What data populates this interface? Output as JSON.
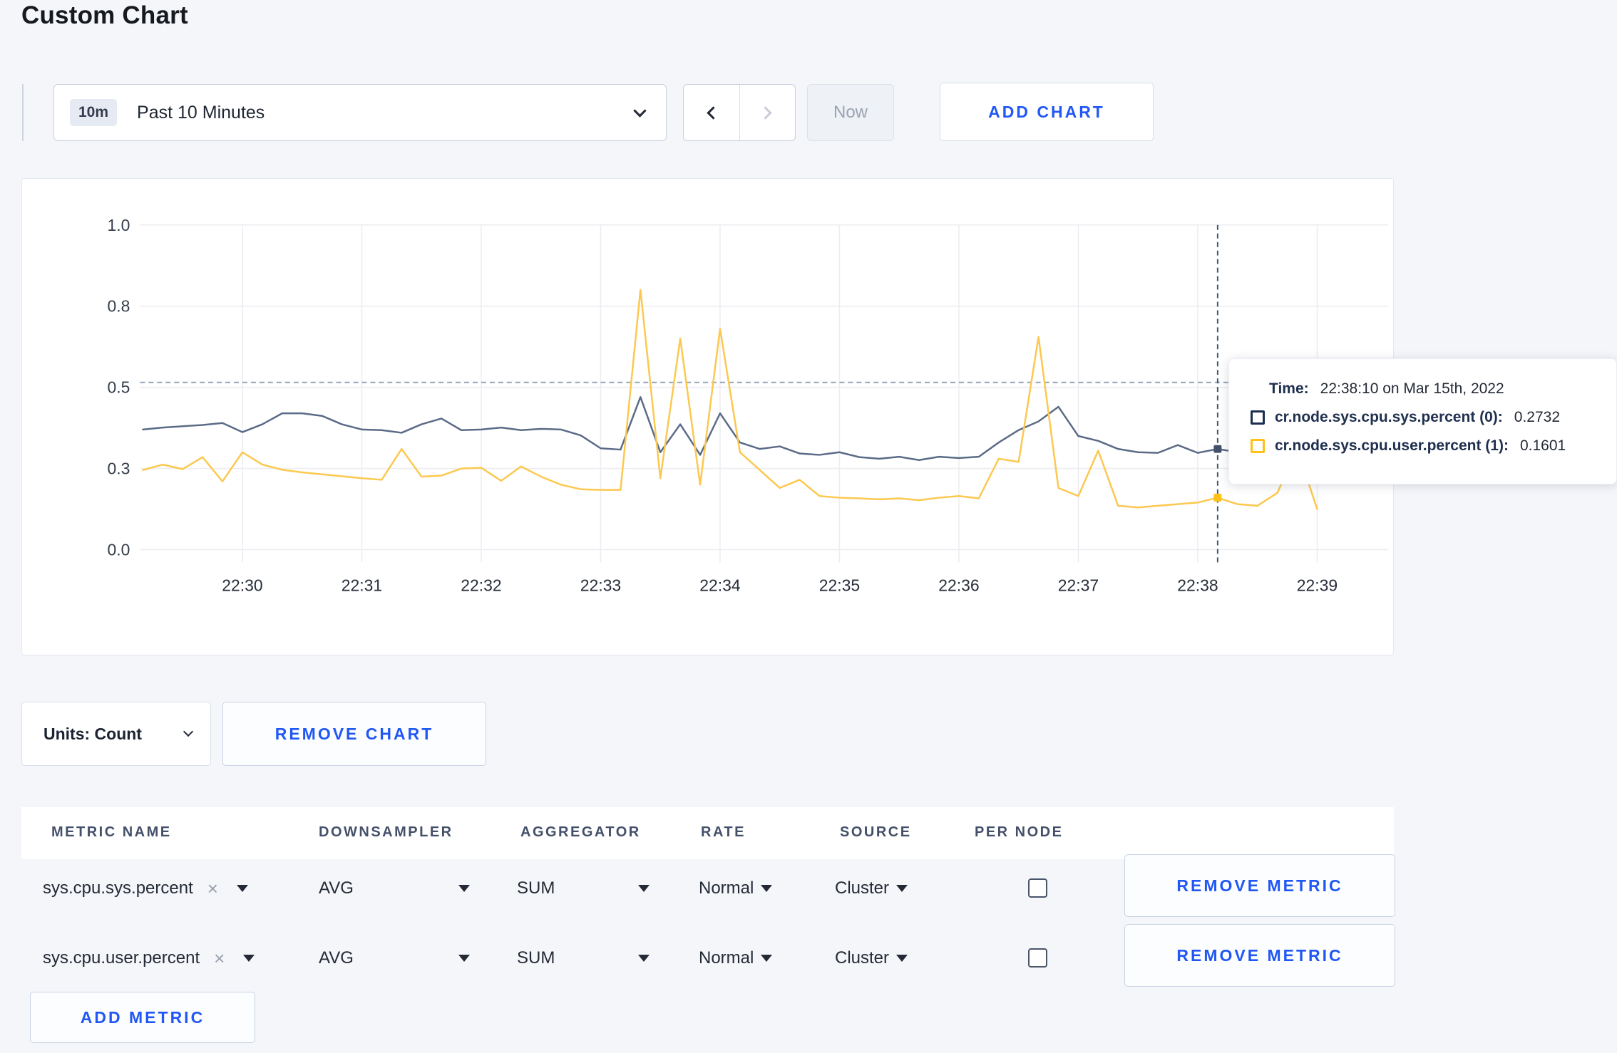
{
  "page": {
    "title": "Custom Chart"
  },
  "toolbar": {
    "range_badge": "10m",
    "range_label": "Past 10 Minutes",
    "now_label": "Now",
    "add_chart_label": "ADD CHART"
  },
  "chart_data": {
    "type": "line",
    "title": "",
    "xlabel": "",
    "ylabel": "",
    "ylim": [
      0,
      1
    ],
    "grid": true,
    "legend_position": "hover-tooltip",
    "y_ticks": {
      "values": [
        0,
        0.25,
        0.5,
        0.75,
        1.0
      ],
      "labels": [
        "0.0",
        "0.3",
        "0.5",
        "0.8",
        "1.0"
      ]
    },
    "x_ticks": [
      {
        "label": "22:30",
        "sec": 50
      },
      {
        "label": "22:31",
        "sec": 110
      },
      {
        "label": "22:32",
        "sec": 170
      },
      {
        "label": "22:33",
        "sec": 230
      },
      {
        "label": "22:34",
        "sec": 290
      },
      {
        "label": "22:35",
        "sec": 350
      },
      {
        "label": "22:36",
        "sec": 410
      },
      {
        "label": "22:37",
        "sec": 470
      },
      {
        "label": "22:38",
        "sec": 530
      },
      {
        "label": "22:39",
        "sec": 590
      }
    ],
    "start_time": "22:29:10",
    "step_sec": 10,
    "crosshair": {
      "time_sec": 540,
      "hline_value": 0.515
    },
    "series": [
      {
        "name": "cr.node.sys.cpu.sys.percent",
        "color": "#5b6b87",
        "hover_value": 0.31,
        "values": [
          0.37,
          0.376,
          0.38,
          0.384,
          0.39,
          0.362,
          0.386,
          0.42,
          0.42,
          0.412,
          0.386,
          0.37,
          0.368,
          0.36,
          0.386,
          0.404,
          0.368,
          0.37,
          0.376,
          0.368,
          0.372,
          0.37,
          0.352,
          0.312,
          0.308,
          0.47,
          0.3,
          0.386,
          0.292,
          0.42,
          0.33,
          0.31,
          0.318,
          0.296,
          0.292,
          0.3,
          0.285,
          0.28,
          0.286,
          0.276,
          0.286,
          0.282,
          0.286,
          0.33,
          0.368,
          0.395,
          0.44,
          0.35,
          0.335,
          0.31,
          0.3,
          0.298,
          0.322,
          0.298,
          0.31,
          0.3,
          0.296,
          0.3,
          0.298,
          0.296
        ]
      },
      {
        "name": "cr.node.sys.cpu.user.percent",
        "color": "#fcc84f",
        "hover_value": 0.16,
        "values": [
          0.245,
          0.262,
          0.248,
          0.285,
          0.21,
          0.3,
          0.262,
          0.246,
          0.238,
          0.232,
          0.226,
          0.22,
          0.215,
          0.31,
          0.225,
          0.228,
          0.25,
          0.252,
          0.212,
          0.256,
          0.225,
          0.2,
          0.186,
          0.184,
          0.184,
          0.8,
          0.22,
          0.65,
          0.2,
          0.68,
          0.3,
          0.245,
          0.19,
          0.215,
          0.165,
          0.16,
          0.158,
          0.155,
          0.158,
          0.152,
          0.16,
          0.165,
          0.158,
          0.28,
          0.27,
          0.655,
          0.19,
          0.165,
          0.305,
          0.135,
          0.13,
          0.135,
          0.14,
          0.145,
          0.16,
          0.14,
          0.135,
          0.175,
          0.31,
          0.125
        ]
      }
    ]
  },
  "tooltip": {
    "time_label": "Time:",
    "time_value": "22:38:10 on Mar 15th, 2022",
    "rows": [
      {
        "label": "cr.node.sys.cpu.sys.percent (0):",
        "value": "0.2732",
        "swatch_color": "#1c2d52"
      },
      {
        "label": "cr.node.sys.cpu.user.percent (1):",
        "value": "0.1601",
        "swatch_color": "#ffc117"
      }
    ]
  },
  "chart_footer": {
    "units_label": "Units: Count",
    "remove_chart_label": "REMOVE CHART"
  },
  "metrics_table": {
    "headers": [
      "METRIC NAME",
      "DOWNSAMPLER",
      "AGGREGATOR",
      "RATE",
      "SOURCE",
      "PER NODE"
    ],
    "rows": [
      {
        "metric": "sys.cpu.sys.percent",
        "clear_icon": "×",
        "downsampler": "AVG",
        "aggregator": "SUM",
        "rate": "Normal",
        "source": "Cluster",
        "per_node_checked": false,
        "remove_label": "REMOVE METRIC"
      },
      {
        "metric": "sys.cpu.user.percent",
        "clear_icon": "×",
        "downsampler": "AVG",
        "aggregator": "SUM",
        "rate": "Normal",
        "source": "Cluster",
        "per_node_checked": false,
        "remove_label": "REMOVE METRIC"
      }
    ],
    "add_metric_label": "ADD METRIC"
  },
  "colors": {
    "accent_blue": "#2057f5",
    "page_bg": "#f5f6fa",
    "grid_line": "#ececf1",
    "crosshair": "#3f586f",
    "hline_dashed": "#92a5ba"
  }
}
